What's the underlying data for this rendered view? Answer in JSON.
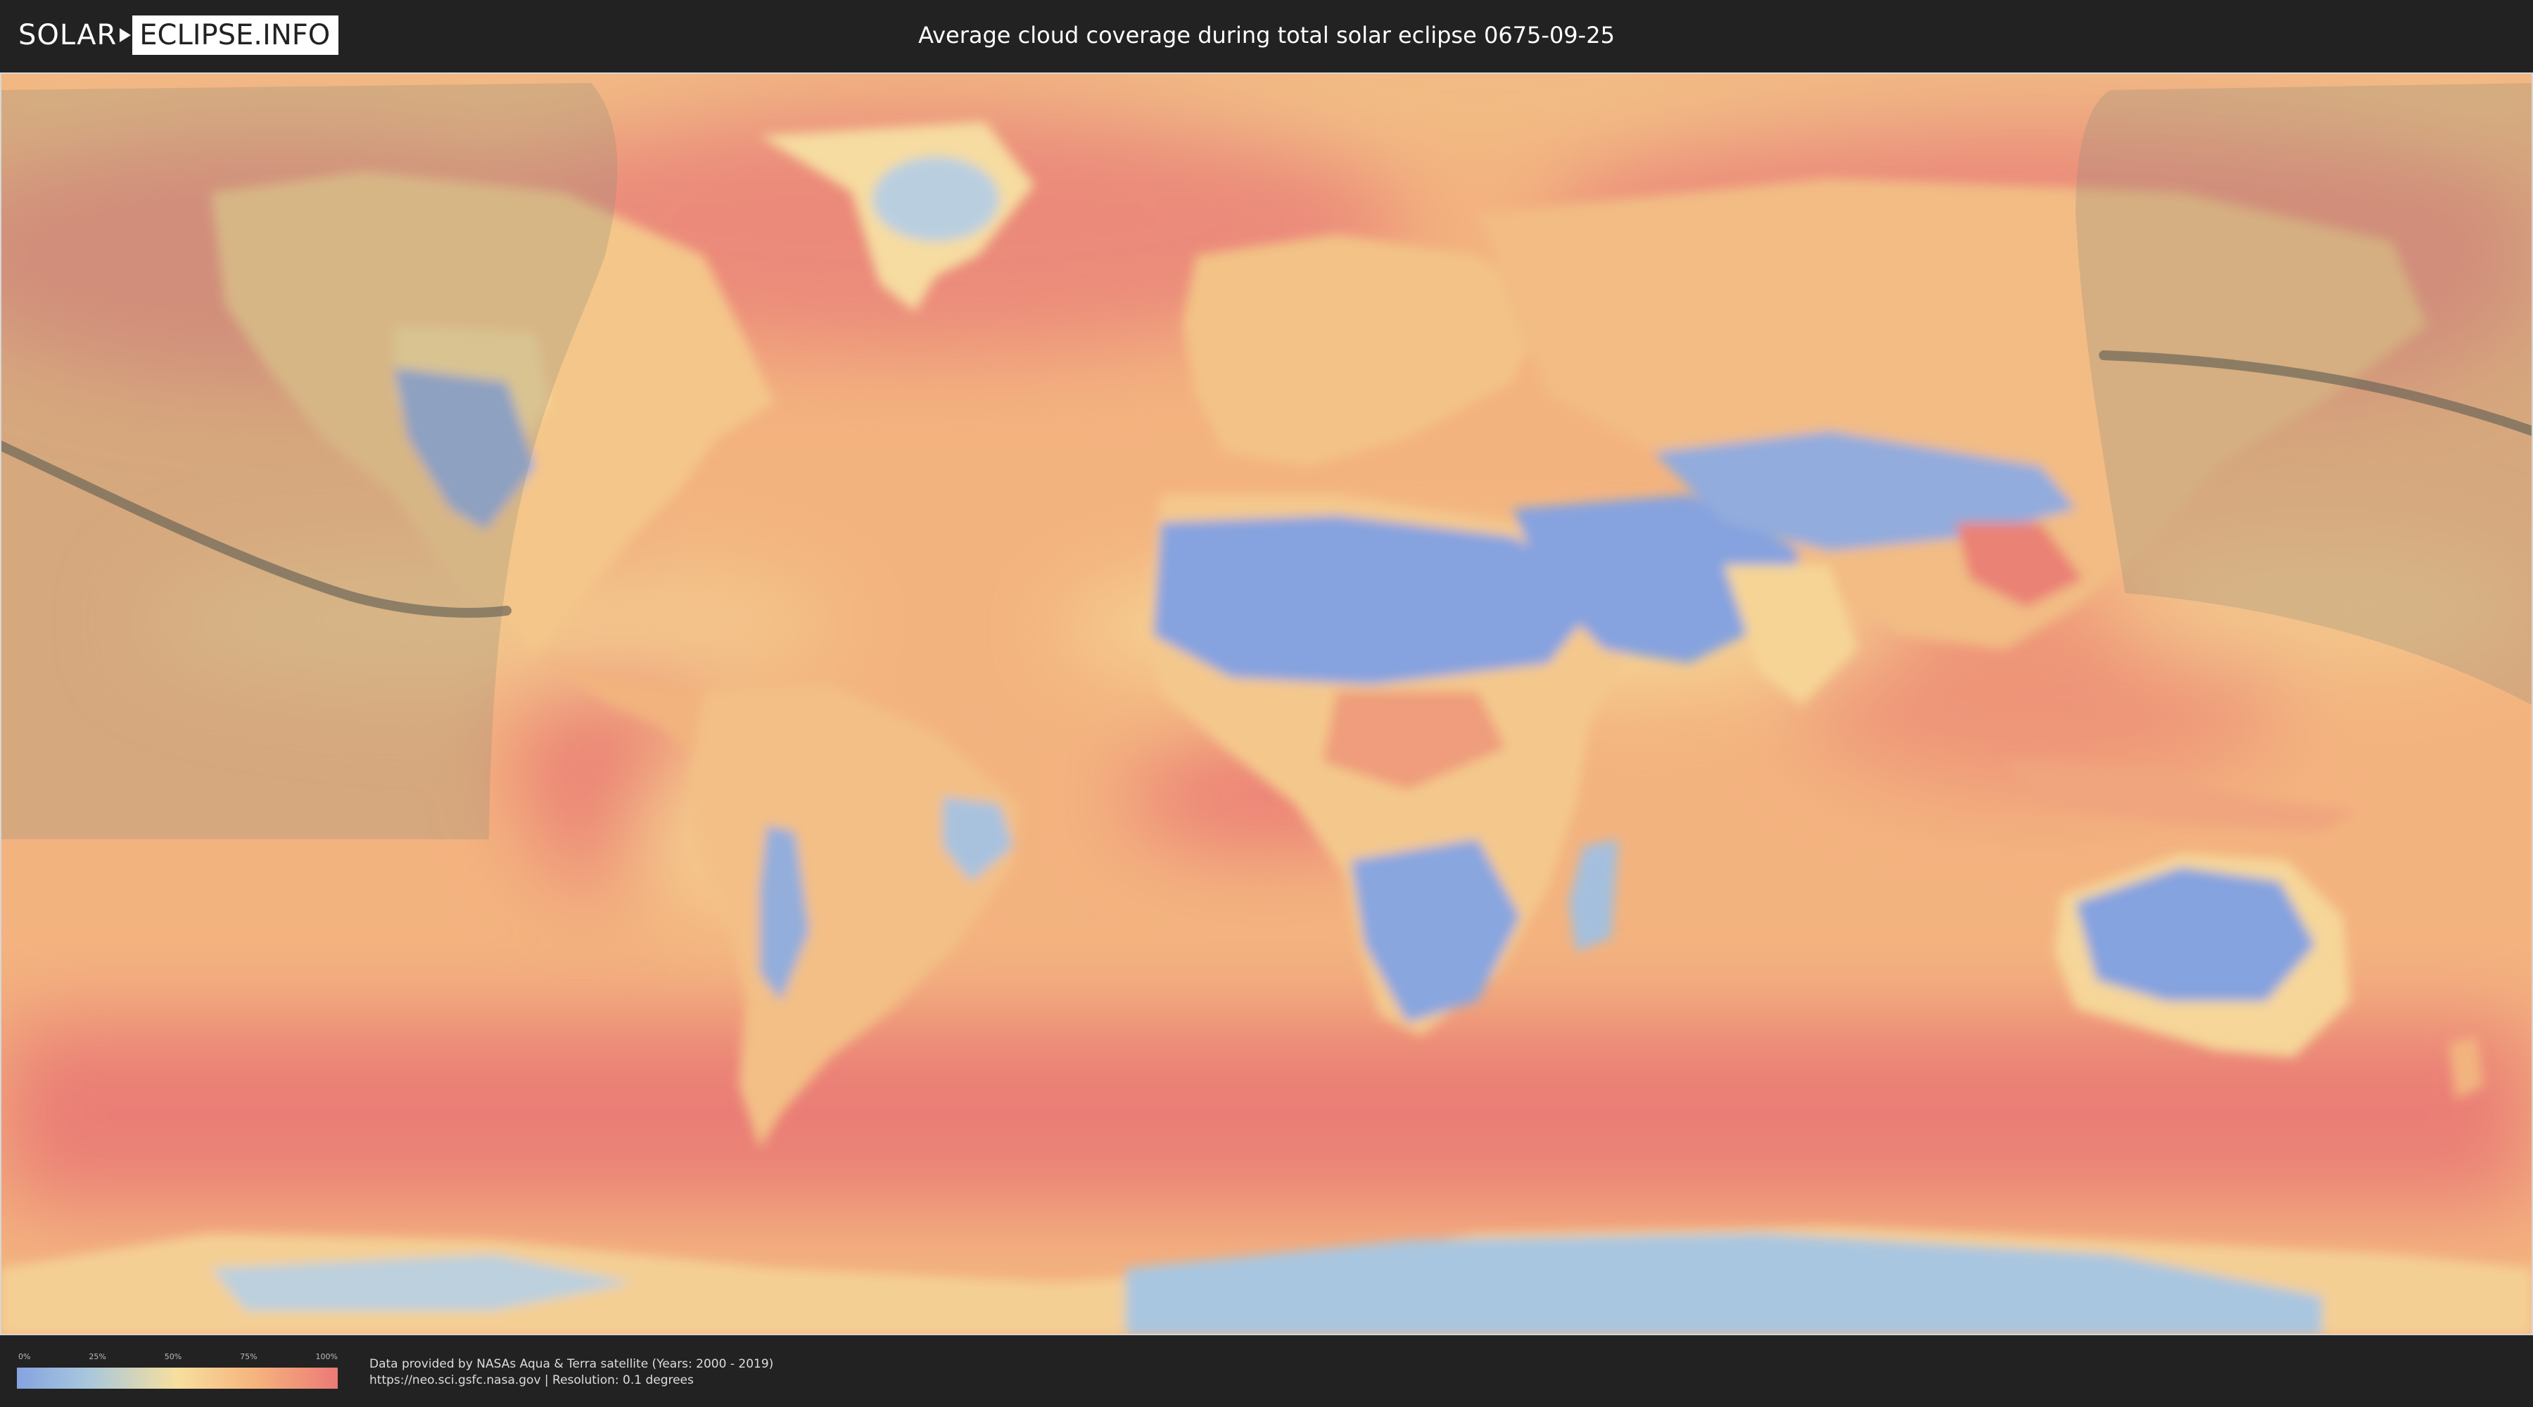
{
  "header": {
    "logo_solar": "SOLAR",
    "logo_eclipse": "ECLIPSE.INFO",
    "title": "Average cloud coverage during total solar eclipse 0675-09-25"
  },
  "map": {
    "kind": "world cloud coverage map",
    "projection": "equirectangular",
    "overlay": "eclipse visibility region and path of totality",
    "palette": {
      "clear": "#85a3e0",
      "low": "#a8c7dc",
      "mid": "#f7df9e",
      "high": "#f5b27d",
      "overcast": "#eb7a76",
      "shadow": "#8c8c7a",
      "path": "#6e6658"
    }
  },
  "legend": {
    "ticks": [
      "0%",
      "25%",
      "50%",
      "75%",
      "100%"
    ]
  },
  "footer": {
    "credit_line1": "Data provided by NASAs Aqua & Terra satellite (Years: 2000 - 2019)",
    "credit_line2": "https://neo.sci.gsfc.nasa.gov | Resolution: 0.1 degrees"
  }
}
